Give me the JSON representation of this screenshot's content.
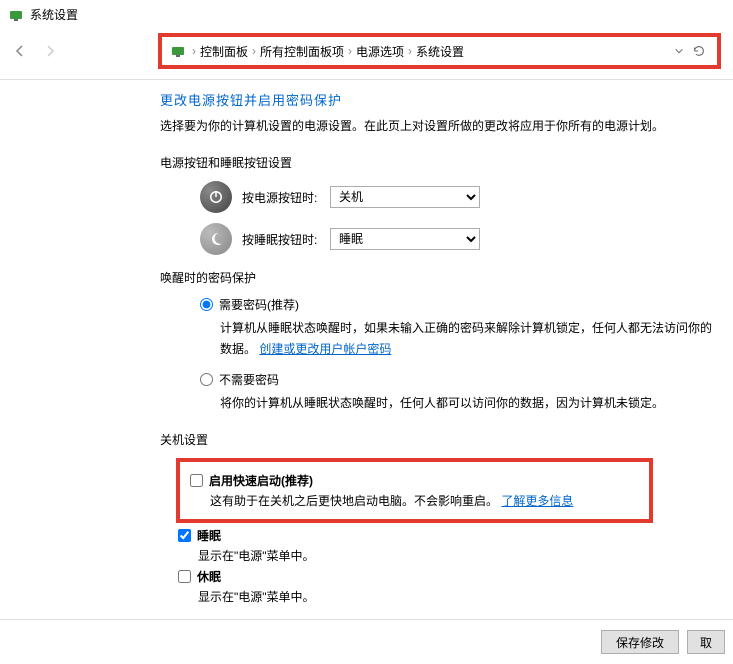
{
  "window": {
    "title": "系统设置"
  },
  "breadcrumb": {
    "items": [
      "控制面板",
      "所有控制面板项",
      "电源选项",
      "系统设置"
    ]
  },
  "top_link": "更改电源按钮并启用密码保护",
  "desc": "选择要为你的计算机设置的电源设置。在此页上对设置所做的更改将应用于你所有的电源计划。",
  "section1": {
    "title": "电源按钮和睡眠按钮设置",
    "power_label": "按电源按钮时:",
    "power_value": "关机",
    "sleep_label": "按睡眠按钮时:",
    "sleep_value": "睡眠"
  },
  "section2": {
    "title": "唤醒时的密码保护",
    "opt1_label": "需要密码(推荐)",
    "opt1_desc_a": "计算机从睡眠状态唤醒时，如果未输入正确的密码来解除计算机锁定，任何人都无法访问你的数据。",
    "opt1_link": "创建或更改用户帐户密码",
    "opt2_label": "不需要密码",
    "opt2_desc": "将你的计算机从睡眠状态唤醒时，任何人都可以访问你的数据，因为计算机未锁定。"
  },
  "section3": {
    "title": "关机设置",
    "fast_label": "启用快速启动(推荐)",
    "fast_desc": "这有助于在关机之后更快地启动电脑。不会影响重启。",
    "fast_link": "了解更多信息",
    "sleep_label": "睡眠",
    "sleep_desc": "显示在\"电源\"菜单中。",
    "hibernate_label": "休眠",
    "hibernate_desc": "显示在\"电源\"菜单中。"
  },
  "footer": {
    "save": "保存修改",
    "cancel": "取"
  }
}
